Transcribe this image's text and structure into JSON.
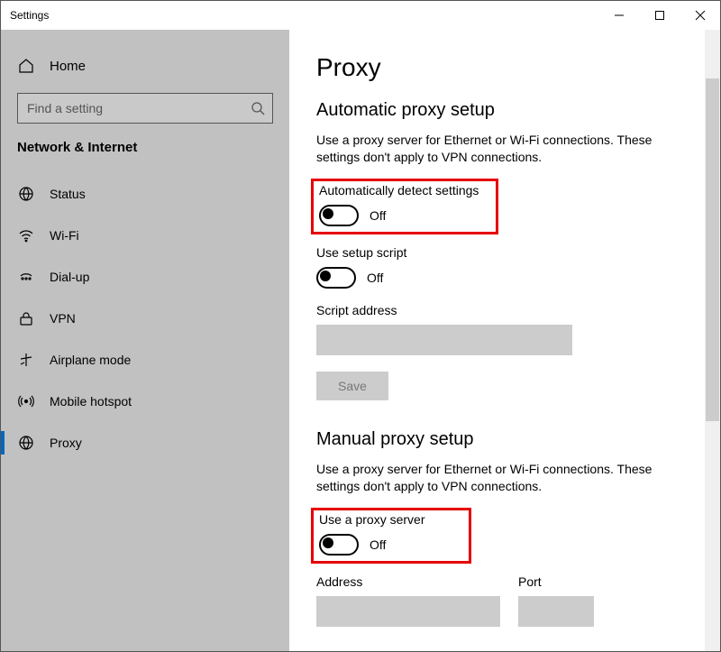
{
  "titlebar": {
    "title": "Settings"
  },
  "sidebar": {
    "home": "Home",
    "search_placeholder": "Find a setting",
    "category": "Network & Internet",
    "items": [
      {
        "label": "Status",
        "icon": "status"
      },
      {
        "label": "Wi-Fi",
        "icon": "wifi"
      },
      {
        "label": "Dial-up",
        "icon": "dialup"
      },
      {
        "label": "VPN",
        "icon": "vpn"
      },
      {
        "label": "Airplane mode",
        "icon": "airplane"
      },
      {
        "label": "Mobile hotspot",
        "icon": "hotspot"
      },
      {
        "label": "Proxy",
        "icon": "proxy",
        "selected": true
      }
    ]
  },
  "main": {
    "title": "Proxy",
    "auto": {
      "heading": "Automatic proxy setup",
      "desc": "Use a proxy server for Ethernet or Wi-Fi connections. These settings don't apply to VPN connections.",
      "detect_label": "Automatically detect settings",
      "detect_state": "Off",
      "script_label": "Use setup script",
      "script_state": "Off",
      "script_addr_label": "Script address",
      "save": "Save"
    },
    "manual": {
      "heading": "Manual proxy setup",
      "desc": "Use a proxy server for Ethernet or Wi-Fi connections. These settings don't apply to VPN connections.",
      "use_label": "Use a proxy server",
      "use_state": "Off",
      "address_label": "Address",
      "port_label": "Port"
    }
  }
}
